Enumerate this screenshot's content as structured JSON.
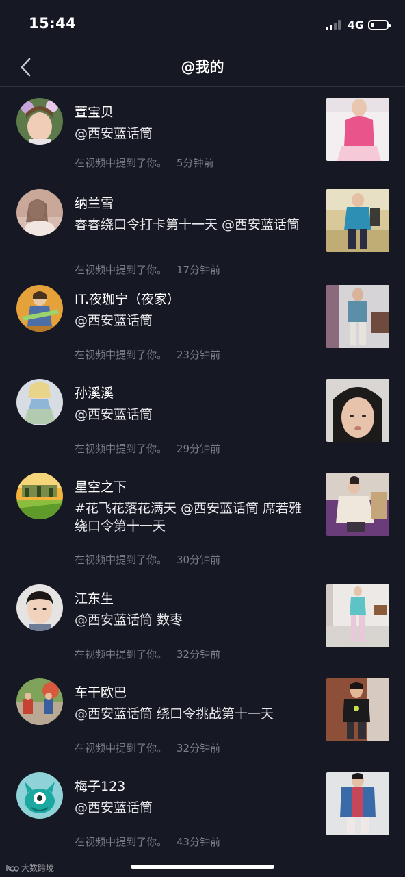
{
  "status": {
    "time": "15:44",
    "network": "4G",
    "battery_level": 0.18
  },
  "header": {
    "title": "@我的"
  },
  "mentions": [
    {
      "name": "萱宝贝",
      "content": "@西安蓝话筒",
      "meta": "在视频中提到了你。",
      "time": "5分钟前"
    },
    {
      "name": "纳兰雪",
      "content": "睿睿绕口令打卡第十一天 @西安蓝话筒",
      "meta": "在视频中提到了你。",
      "time": "17分钟前"
    },
    {
      "name": "IT.夜珈宁（夜家）",
      "content": "@西安蓝话筒",
      "meta": "在视频中提到了你。",
      "time": "23分钟前"
    },
    {
      "name": "孙溪溪",
      "content": "@西安蓝话筒",
      "meta": "在视频中提到了你。",
      "time": "29分钟前"
    },
    {
      "name": "星空之下",
      "content": "#花飞花落花满天 @西安蓝话筒 席若雅绕口令第十一天",
      "meta": "在视频中提到了你。",
      "time": "30分钟前"
    },
    {
      "name": "江东生",
      "content": "@西安蓝话筒 数枣",
      "meta": "在视频中提到了你。",
      "time": "32分钟前"
    },
    {
      "name": "车干欧巴",
      "content": "@西安蓝话筒 绕口令挑战第十一天",
      "meta": "在视频中提到了你。",
      "time": "32分钟前"
    },
    {
      "name": "梅子123",
      "content": "@西安蓝话筒",
      "meta": "在视频中提到了你。",
      "time": "43分钟前"
    }
  ],
  "watermark": "大数跨境"
}
